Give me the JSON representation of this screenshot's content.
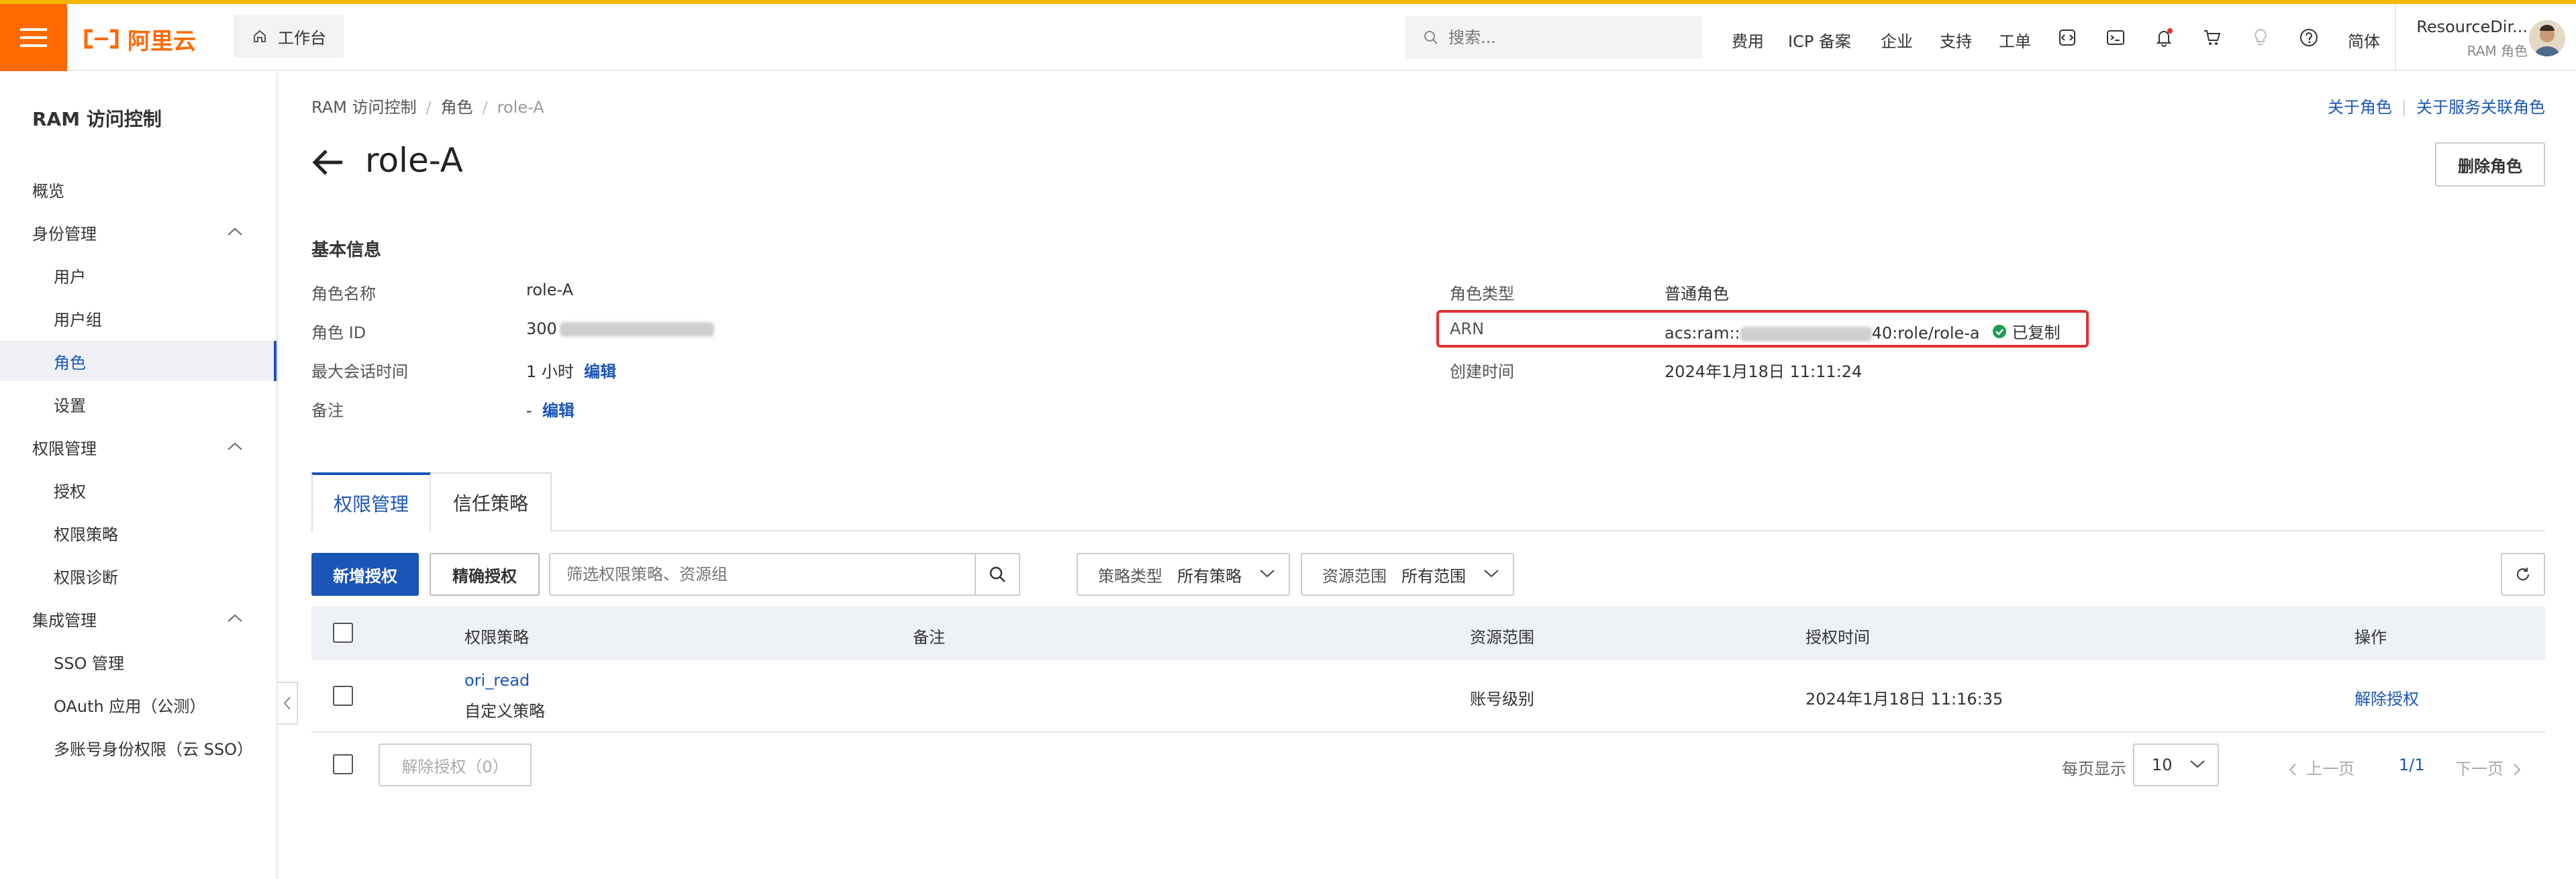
{
  "colors": {
    "brand": "#ff6a00",
    "primary": "#1a55b8",
    "highlight": "#e3322f",
    "success": "#1e9c4a"
  },
  "header": {
    "logo": "阿里云",
    "workbench": "工作台",
    "search_placeholder": "搜索...",
    "links": [
      "费用",
      "ICP 备案",
      "企业",
      "支持",
      "工单"
    ],
    "lang": "简体",
    "account_name": "ResourceDir...",
    "account_role": "RAM 角色",
    "icons": [
      "code-icon",
      "terminal-icon",
      "bell-icon",
      "cart-icon",
      "lightbulb-icon",
      "help-icon"
    ]
  },
  "sidebar": {
    "title": "RAM 访问控制",
    "overview": "概览",
    "groups": [
      {
        "label": "身份管理",
        "items": [
          "用户",
          "用户组",
          "角色",
          "设置"
        ]
      },
      {
        "label": "权限管理",
        "items": [
          "授权",
          "权限策略",
          "权限诊断"
        ]
      },
      {
        "label": "集成管理",
        "items": [
          "SSO 管理",
          "OAuth 应用（公测）",
          "多账号身份权限（云 SSO）"
        ]
      }
    ],
    "active_item": "角色"
  },
  "breadcrumb": [
    "RAM 访问控制",
    "角色",
    "role-A"
  ],
  "top_links": [
    "关于角色",
    "关于服务关联角色"
  ],
  "page_title": "role-A",
  "delete_button": "删除角色",
  "basic_info": {
    "title": "基本信息",
    "role_name_label": "角色名称",
    "role_name": "role-A",
    "role_id_label": "角色 ID",
    "role_id_prefix": "300",
    "max_session_label": "最大会话时间",
    "max_session": "1 小时",
    "edit": "编辑",
    "note_label": "备注",
    "note": "-",
    "role_type_label": "角色类型",
    "role_type": "普通角色",
    "arn_label": "ARN",
    "arn_prefix": "acs:ram::",
    "arn_suffix": "40:role/role-a",
    "copied": "已复制",
    "created_label": "创建时间",
    "created": "2024年1月18日 11:11:24"
  },
  "tabs": [
    "权限管理",
    "信任策略"
  ],
  "toolbar": {
    "add_grant": "新增授权",
    "precise_grant": "精确授权",
    "filter_placeholder": "筛选权限策略、资源组",
    "policy_type_label": "策略类型",
    "policy_type_value": "所有策略",
    "scope_label": "资源范围",
    "scope_value": "所有范围"
  },
  "table": {
    "columns": [
      "权限策略",
      "备注",
      "资源范围",
      "授权时间",
      "操作"
    ],
    "rows": [
      {
        "policy": "ori_read",
        "policy_type": "自定义策略",
        "note": "",
        "scope": "账号级别",
        "time": "2024年1月18日 11:16:35",
        "action": "解除授权"
      }
    ]
  },
  "footer": {
    "unauth_button": "解除授权（0）",
    "per_page_label": "每页显示",
    "per_page": "10",
    "prev": "上一页",
    "page": "1/1",
    "next": "下一页"
  }
}
